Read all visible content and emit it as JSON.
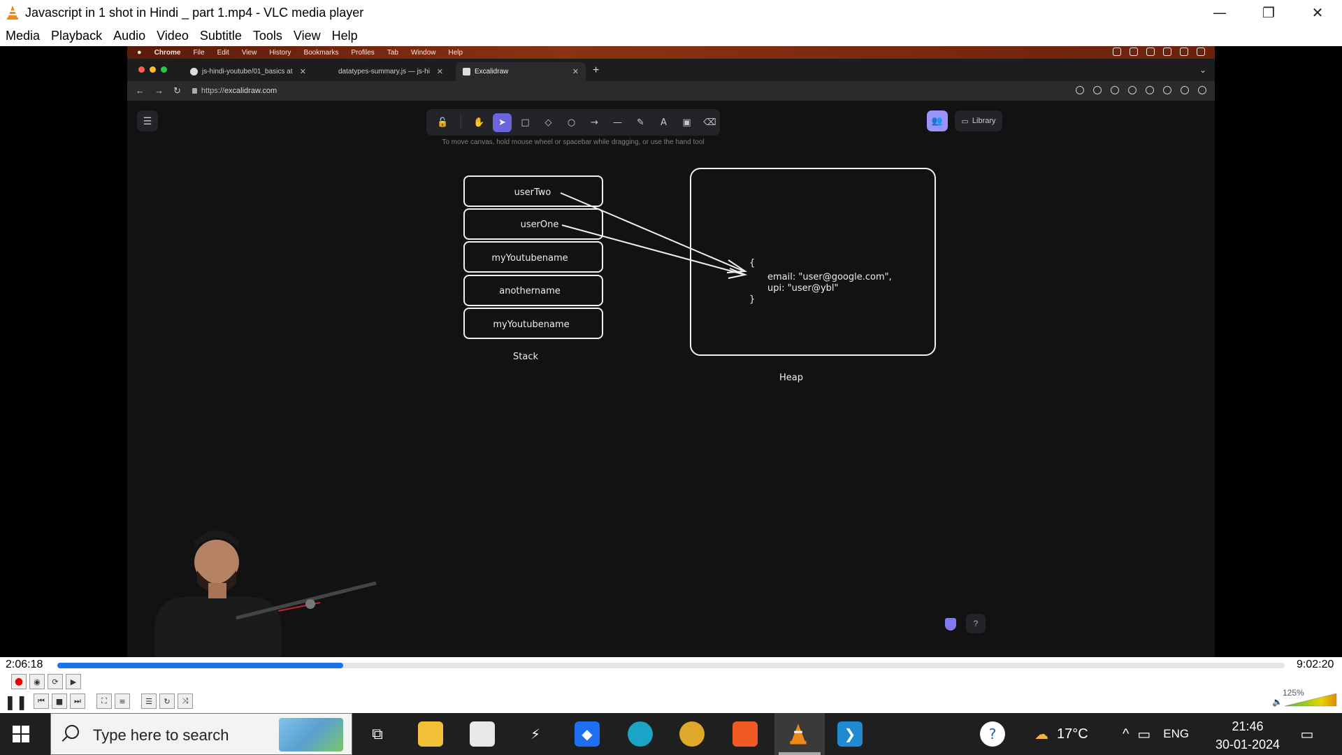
{
  "window": {
    "title": "Javascript in 1 shot in Hindi _ part 1.mp4 - VLC media player",
    "minimize": "—",
    "restore": "❐",
    "close": "✕"
  },
  "menu": [
    "Media",
    "Playback",
    "Audio",
    "Video",
    "Subtitle",
    "Tools",
    "View",
    "Help"
  ],
  "mac_menu": {
    "app": "Chrome",
    "items": [
      "File",
      "Edit",
      "View",
      "History",
      "Bookmarks",
      "Profiles",
      "Tab",
      "Window",
      "Help"
    ]
  },
  "browser": {
    "tabs": [
      {
        "label": "js-hindi-youtube/01_basics at"
      },
      {
        "label": "datatypes-summary.js — js-hi"
      },
      {
        "label": "Excalidraw"
      }
    ],
    "new_tab": "+",
    "url_prefix": "https://",
    "url_host": "excalidraw.com"
  },
  "excalidraw": {
    "hint": "To move canvas, hold mouse wheel or spacebar while dragging, or use the hand tool",
    "library": "Library",
    "tools": [
      "lock",
      "hand",
      "selection",
      "rectangle",
      "diamond",
      "ellipse",
      "arrow",
      "line",
      "draw",
      "text",
      "image",
      "eraser"
    ],
    "tool_glyphs": [
      "🔓",
      "✋",
      "➤",
      "□",
      "◇",
      "○",
      "→",
      "—",
      "✎",
      "A",
      "▣",
      "⌫"
    ],
    "stack_items": [
      "userTwo",
      "userOne",
      "myYoutubename",
      "anothername",
      "myYoutubename"
    ],
    "stack_label": "Stack",
    "heap_label": "Heap",
    "heap_open": "{",
    "heap_line1": "email: \"user@google.com\",",
    "heap_line2": "upi: \"user@ybl\"",
    "heap_close": "}"
  },
  "player": {
    "elapsed": "2:06:18",
    "total": "9:02:20",
    "progress": 0.233,
    "volume": "125%"
  },
  "taskbar": {
    "search_placeholder": "Type here to search",
    "weather": "17°C",
    "lang": "ENG",
    "time": "21:46",
    "date": "30-01-2024"
  },
  "colors": {
    "accent": "#6965db",
    "seek_fill": "#1a73e8",
    "taskbar": "#1f1f1f"
  }
}
